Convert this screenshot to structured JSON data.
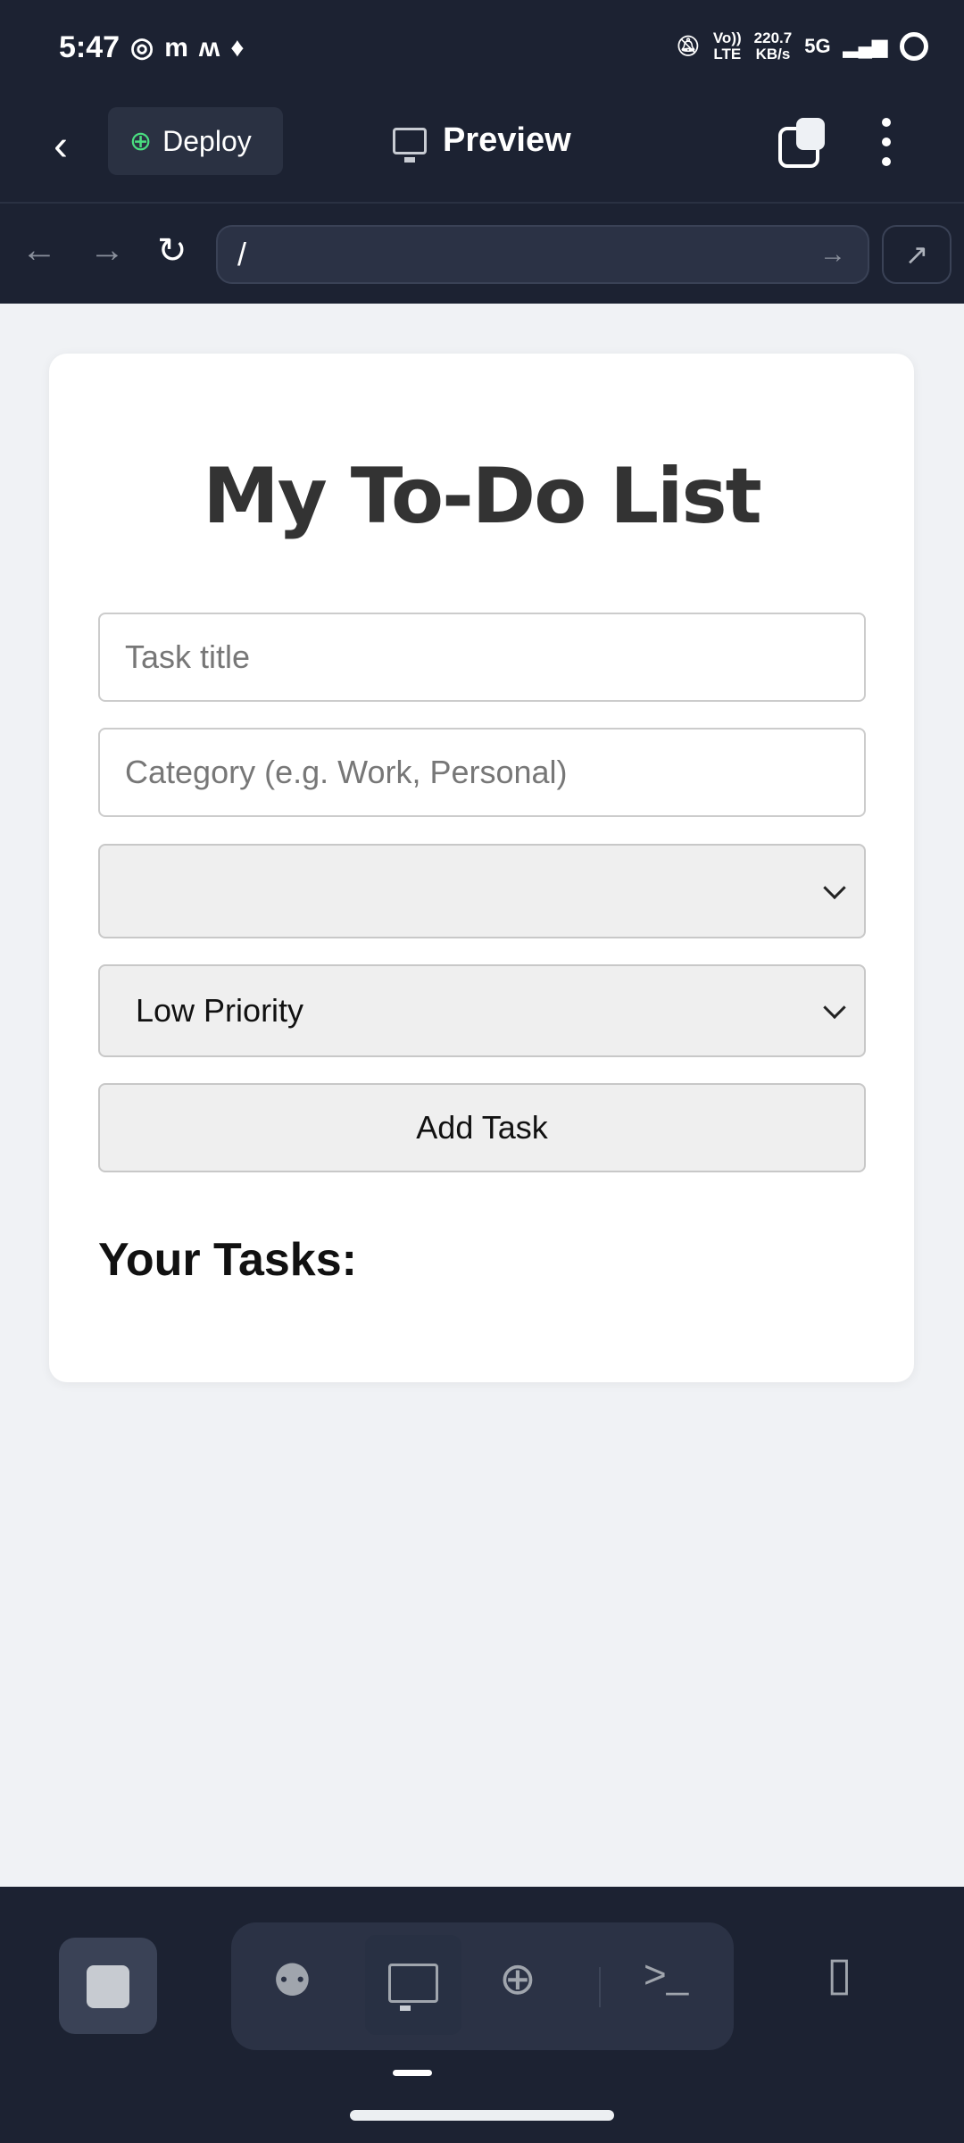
{
  "status_bar": {
    "time": "5:47",
    "notification_icons": [
      "whatsapp-icon",
      "m-icon",
      "m-icon",
      "swiggy-icon"
    ],
    "volte": "Vo))",
    "lte": "LTE",
    "speed": "220.7",
    "speed_unit": "KB/s",
    "network": "5G"
  },
  "header": {
    "deploy_label": "Deploy",
    "title": "Preview"
  },
  "browser": {
    "url": "/"
  },
  "app": {
    "title": "My To-Do List",
    "task_title_placeholder": "Task title",
    "category_placeholder": "Category (e.g. Work, Personal)",
    "first_select_value": "",
    "priority_value": "Low Priority",
    "add_button": "Add Task",
    "tasks_heading": "Your Tasks:"
  },
  "colors": {
    "chrome": "#1c2232",
    "page_bg": "#f0f2f5",
    "deploy_green": "#4ade80"
  }
}
